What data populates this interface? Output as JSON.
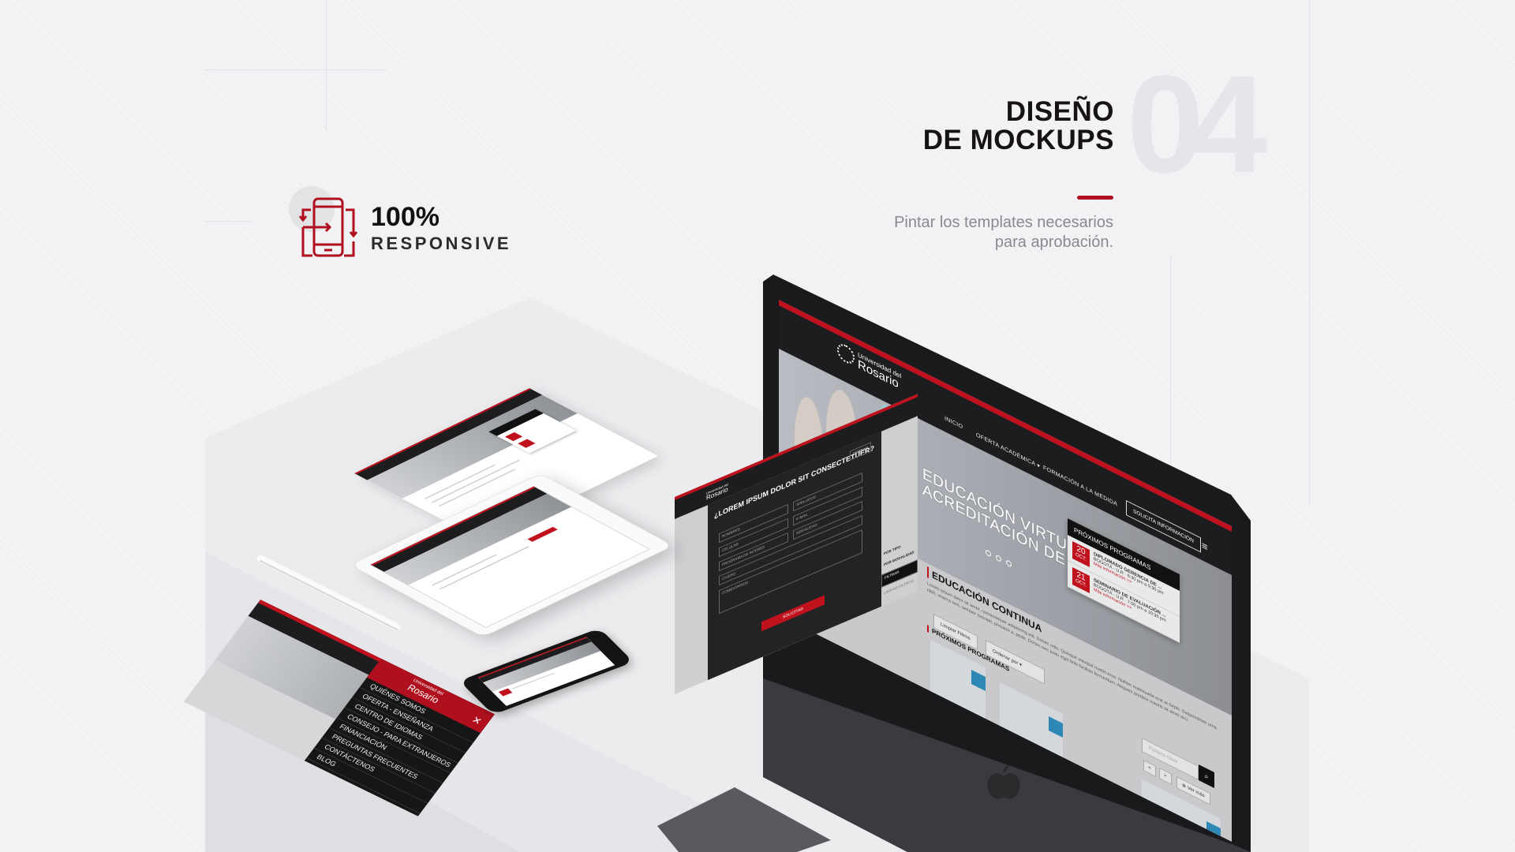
{
  "section": {
    "number": "04",
    "title_line1": "DISEÑO",
    "title_line2": "DE MOCKUPS",
    "subtitle_line1": "Pintar los templates necesarios",
    "subtitle_line2": "para aprobación."
  },
  "badge": {
    "percent": "100%",
    "label": "RESPONSIVE",
    "icon": "responsive-phone-rotate-icon"
  },
  "colors": {
    "accent": "#b0101d",
    "dark": "#1d1d1f",
    "background": "#f1f1f4"
  },
  "site": {
    "logo_small": "Universidad del",
    "logo_big": "Rosario",
    "nav": [
      "INICIO",
      "OFERTA ACADÉMICA ▾",
      "FORMACIÓN A LA MEDIDA"
    ],
    "cta": "SOLICITA INFORMACIÓN",
    "hero_line1": "EDUCACIÓN VIRTUAL",
    "hero_line2": "ACREDITACIÓN DE ALTA CALIDAD",
    "programs_title": "PRÓXIMOS PROGRAMAS",
    "programs": [
      {
        "day": "20",
        "month": "OCT.",
        "name": "DIPLOMADO GERENCIA DE ...",
        "place": "BOGOTÁ - U.R",
        "time": "6:30 pm a 9:30 pm",
        "more": "Más información >>"
      },
      {
        "day": "21",
        "month": "OCT.",
        "name": "SEMINARIO DE EVALUACIÓN ...",
        "place": "BOGOTÁ - U.R",
        "time": "7:00 pm a 10:30 pm",
        "more": "Más información >>"
      }
    ],
    "section_title": "EDUCACIÓN CONTINUA",
    "lorem": "Lorem ipsum dolor sit amet, consectetuer adipiscing elit. Donec odio. Quisque volutpat mattis eros. Nullam malesuada erat ut turpis. Suspendisse urna nibh, viverra non, semper suscipit, posuere a, pede. Donec nec justo eget felis facilisis fermentum. Aliquam porttitor mauris sit amet orci.",
    "clear_filters": "Limpiar Filtros",
    "sort_by": "Ordenar por",
    "upcoming_title": "PRÓXIMOS PROGRAMAS",
    "search_placeholder": "Palabra clave",
    "prev": "<",
    "next": ">",
    "see_more": "Ver más"
  },
  "form_panel": {
    "question": "¿LOREM IPSUM DOLOR SIT CONSECTETUER?",
    "fields": [
      "NOMBRES",
      "APELLIDOS",
      "CELULAR",
      "E-MAIL",
      "PROGRAMA DE INTERÉS",
      "MODALIDAD",
      "CIUDAD",
      "COMENTARIOS"
    ],
    "send": "SOLICITAR",
    "close": "CERRAR",
    "filter_type": "POR TIPO",
    "filter_mode": "POR MODALIDAD",
    "filter_btn": "FILTRAR",
    "clear": "LIMPIAR FILTROS"
  },
  "mobile_menu": {
    "items": [
      "QUIÉNES SOMOS",
      "OFERTA - ENSEÑANZA",
      "CENTRO DE IDIOMAS",
      "CONSEJO - PARA EXTRANJEROS",
      "FINANCIACIÓN",
      "PREGUNTAS FRECUENTES",
      "CONTÁCTENOS",
      "BLOG"
    ]
  }
}
